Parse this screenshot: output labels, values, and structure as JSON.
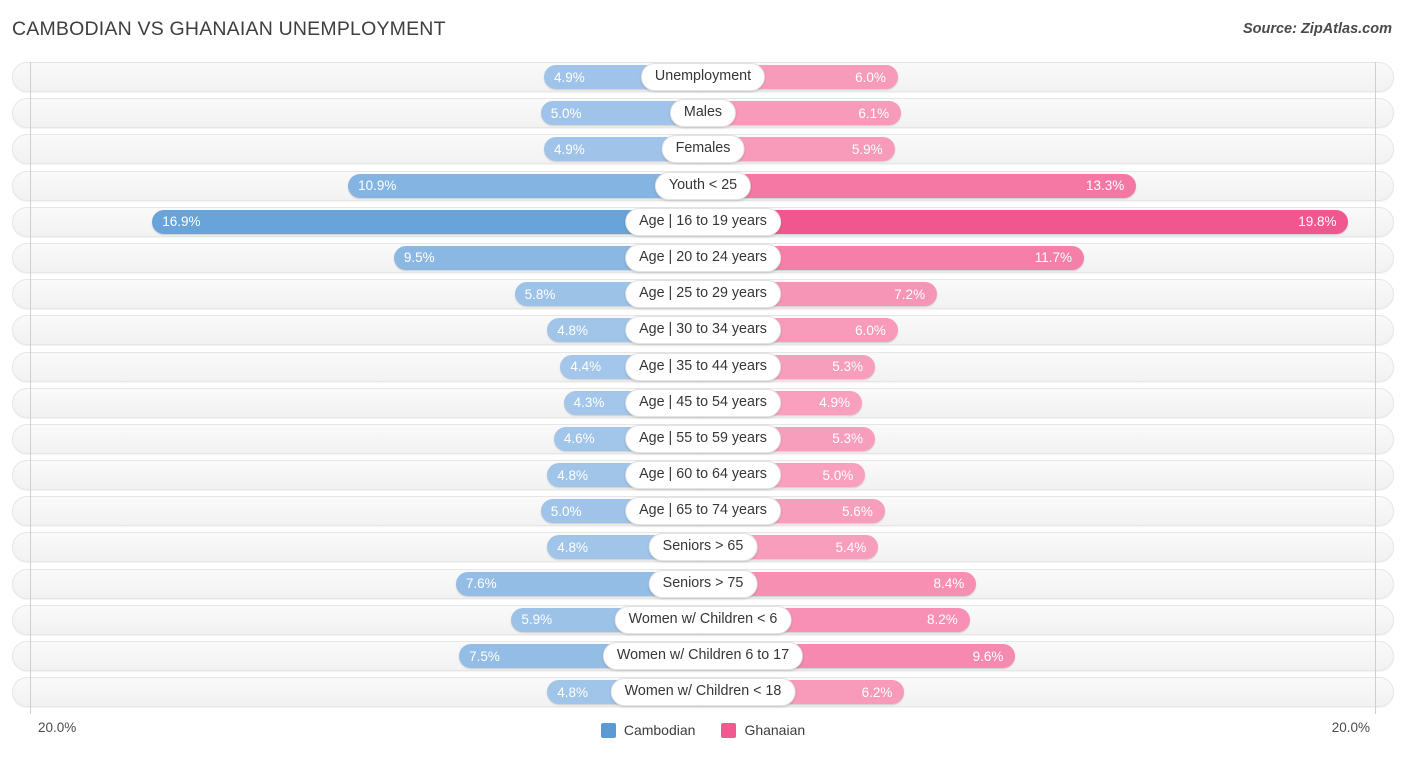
{
  "header": {
    "title": "CAMBODIAN VS GHANAIAN UNEMPLOYMENT",
    "source": "Source: ZipAtlas.com"
  },
  "legend": {
    "items": [
      {
        "label": "Cambodian",
        "color": "#5b9bd5"
      },
      {
        "label": "Ghanaian",
        "color": "#f05a91"
      }
    ]
  },
  "axis": {
    "left_tick": "20.0%",
    "right_tick": "20.0%",
    "max": 20.0
  },
  "colors": {
    "left_light": "#a3c6ea",
    "left_dark": "#5b9bd5",
    "right_light": "#f9a3c0",
    "right_dark": "#f0578f",
    "track": "#f5f5f5",
    "label_text": "#363636"
  },
  "chart_data": {
    "type": "bar",
    "orientation": "horizontal-diverging",
    "title": "CAMBODIAN VS GHANAIAN UNEMPLOYMENT",
    "xlabel": "",
    "ylabel": "",
    "xlim": [
      20.0,
      20.0
    ],
    "grid": false,
    "legend_position": "bottom-center",
    "categories": [
      "Unemployment",
      "Males",
      "Females",
      "Youth < 25",
      "Age | 16 to 19 years",
      "Age | 20 to 24 years",
      "Age | 25 to 29 years",
      "Age | 30 to 34 years",
      "Age | 35 to 44 years",
      "Age | 45 to 54 years",
      "Age | 55 to 59 years",
      "Age | 60 to 64 years",
      "Age | 65 to 74 years",
      "Seniors > 65",
      "Seniors > 75",
      "Women w/ Children < 6",
      "Women w/ Children 6 to 17",
      "Women w/ Children < 18"
    ],
    "series": [
      {
        "name": "Cambodian",
        "color": "#5b9bd5",
        "values": [
          4.9,
          5.0,
          4.9,
          10.9,
          16.9,
          9.5,
          5.8,
          4.8,
          4.4,
          4.3,
          4.6,
          4.8,
          5.0,
          4.8,
          7.6,
          5.9,
          7.5,
          4.8
        ],
        "labels": [
          "4.9%",
          "5.0%",
          "4.9%",
          "10.9%",
          "16.9%",
          "9.5%",
          "5.8%",
          "4.8%",
          "4.4%",
          "4.3%",
          "4.6%",
          "4.8%",
          "5.0%",
          "4.8%",
          "7.6%",
          "5.9%",
          "7.5%",
          "4.8%"
        ]
      },
      {
        "name": "Ghanaian",
        "color": "#f05a91",
        "values": [
          6.0,
          6.1,
          5.9,
          13.3,
          19.8,
          11.7,
          7.2,
          6.0,
          5.3,
          4.9,
          5.3,
          5.0,
          5.6,
          5.4,
          8.4,
          8.2,
          9.6,
          6.2
        ],
        "labels": [
          "6.0%",
          "6.1%",
          "5.9%",
          "13.3%",
          "19.8%",
          "11.7%",
          "7.2%",
          "6.0%",
          "5.3%",
          "4.9%",
          "5.3%",
          "5.0%",
          "5.6%",
          "5.4%",
          "8.4%",
          "8.2%",
          "9.6%",
          "6.2%"
        ]
      }
    ]
  }
}
